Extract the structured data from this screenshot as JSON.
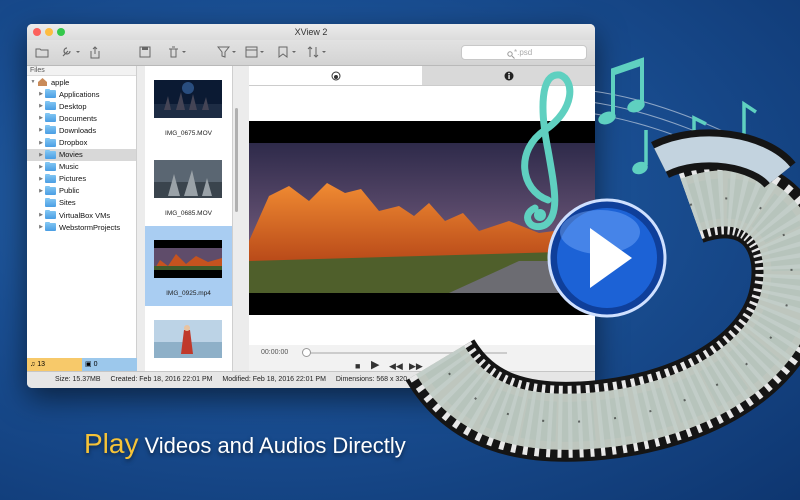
{
  "window": {
    "title": "XView 2",
    "search_placeholder": "*.psd"
  },
  "sidebar": {
    "header": "Files",
    "root": "apple",
    "items": [
      {
        "label": "Applications"
      },
      {
        "label": "Desktop"
      },
      {
        "label": "Documents"
      },
      {
        "label": "Downloads"
      },
      {
        "label": "Dropbox"
      },
      {
        "label": "Movies",
        "selected": true
      },
      {
        "label": "Music"
      },
      {
        "label": "Pictures"
      },
      {
        "label": "Public"
      },
      {
        "label": "Sites"
      },
      {
        "label": "VirtualBox VMs"
      },
      {
        "label": "WebstormProjects"
      }
    ],
    "count_audio": "13",
    "count_image": "0"
  },
  "thumbnails": [
    {
      "name": "IMG_0675.MOV"
    },
    {
      "name": "IMG_0685.MOV"
    },
    {
      "name": "IMG_0925.mp4",
      "selected": true
    },
    {
      "name": ""
    }
  ],
  "player": {
    "time": "00:00:00"
  },
  "infobar": {
    "size": "Size: 15.37MB",
    "created": "Created: Feb 18, 2016 22:01 PM",
    "modified": "Modified: Feb 18, 2016 22:01 PM",
    "dimensions": "Dimensions: 568 x 320",
    "duration": "Dura"
  },
  "tagline": {
    "highlight": "Play",
    "rest": "Videos and Audios Directly"
  },
  "colors": {
    "accent_yellow": "#f6c338",
    "selection_blue": "#a9cdf2",
    "audio_badge": "#f7c96a",
    "image_badge": "#9cc8ec"
  }
}
